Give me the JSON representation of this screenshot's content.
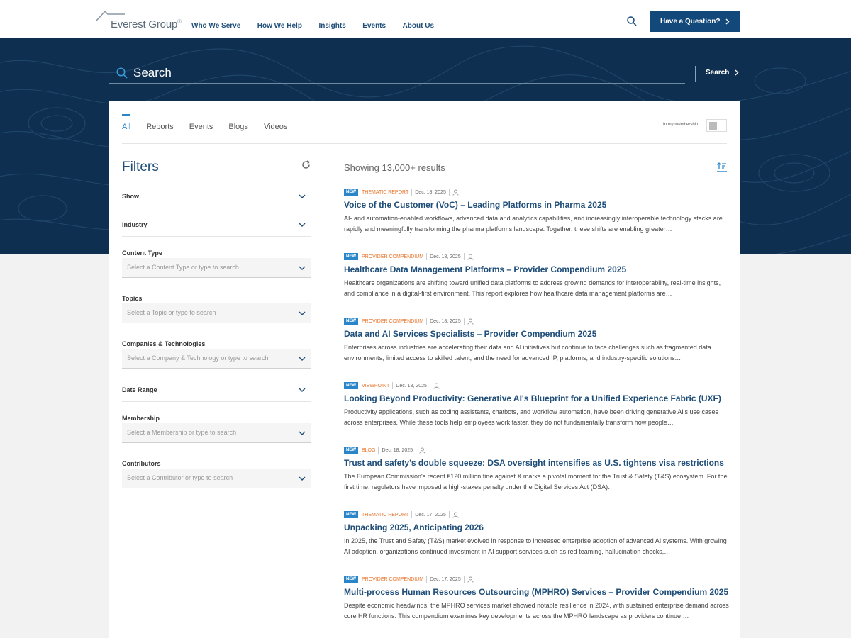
{
  "header": {
    "logo_text": "Everest Group",
    "logo_reg": "®",
    "nav": [
      "Who We Serve",
      "How We Help",
      "Insights",
      "Events",
      "About Us"
    ],
    "question_button": "Have a Question?"
  },
  "hero": {
    "search_placeholder": "Search",
    "search_button": "Search"
  },
  "tabs": [
    "All",
    "Reports",
    "Events",
    "Blogs",
    "Videos"
  ],
  "membership_label": "In my membership",
  "filters": {
    "title": "Filters",
    "items": [
      {
        "label": "Show",
        "placeholder": ""
      },
      {
        "label": "Industry",
        "placeholder": ""
      },
      {
        "label": "Content Type",
        "placeholder": "Select a Content Type or type to search"
      },
      {
        "label": "Topics",
        "placeholder": "Select a Topic or type to search"
      },
      {
        "label": "Companies & Technologies",
        "placeholder": "Select a Company & Technology or type to search"
      },
      {
        "label": "Date Range",
        "placeholder": ""
      },
      {
        "label": "Membership",
        "placeholder": "Select a Membership or type to search"
      },
      {
        "label": "Contributors",
        "placeholder": "Select a Contributor or type to search"
      }
    ]
  },
  "results": {
    "count_text": "Showing 13,000+ results",
    "items": [
      {
        "badge": "NEW",
        "type": "THEMATIC REPORT",
        "date": "Dec. 18, 2025",
        "title": "Voice of the Customer (VoC) – Leading Platforms in Pharma 2025",
        "desc": "AI- and automation-enabled workflows, advanced data and analytics capabilities, and increasingly interoperable technology stacks are rapidly and meaningfully transforming the pharma platforms landscape. Together, these shifts are enabling greater…"
      },
      {
        "badge": "NEW",
        "type": "PROVIDER COMPENDIUM",
        "date": "Dec. 18, 2025",
        "title": "Healthcare Data Management Platforms – Provider Compendium 2025",
        "desc": "Healthcare organizations are shifting toward unified data platforms to address growing demands for interoperability, real-time insights, and compliance in a digital-first environment. This report explores how healthcare data management platforms are…"
      },
      {
        "badge": "NEW",
        "type": "PROVIDER COMPENDIUM",
        "date": "Dec. 18, 2025",
        "title": "Data and AI Services Specialists – Provider Compendium 2025",
        "desc": "Enterprises across industries are accelerating their data and AI initiatives but continue to face challenges such as fragmented data environments, limited access to skilled talent, and the need for advanced IP, platforms, and industry-specific solutions.…"
      },
      {
        "badge": "NEW",
        "type": "VIEWPOINT",
        "date": "Dec. 18, 2025",
        "title": "Looking Beyond Productivity: Generative AI's Blueprint for a Unified Experience Fabric (UXF)",
        "desc": "Productivity applications, such as coding assistants, chatbots, and workflow automation, have been driving generative AI's use cases across enterprises. While these tools help employees work faster, they do not fundamentally transform how people…"
      },
      {
        "badge": "NEW",
        "type": "BLOG",
        "date": "Dec. 18, 2025",
        "title": "Trust and safety’s double squeeze: DSA oversight intensifies as U.S. tightens visa restrictions",
        "desc": "The European Commission's recent €120 million fine against X marks a pivotal moment for the Trust & Safety (T&S) ecosystem. For the first time, regulators have imposed a high-stakes penalty under the Digital Services Act (DSA)…"
      },
      {
        "badge": "NEW",
        "type": "THEMATIC REPORT",
        "date": "Dec. 17, 2025",
        "title": "Unpacking 2025, Anticipating 2026",
        "desc": "In 2025, the Trust and Safety (T&S) market evolved in response to increased enterprise adoption of advanced AI systems. With growing AI adoption, organizations continued investment in AI support services such as red teaming, hallucination checks,…"
      },
      {
        "badge": "NEW",
        "type": "PROVIDER COMPENDIUM",
        "date": "Dec. 17, 2025",
        "title": "Multi-process Human Resources Outsourcing (MPHRO) Services – Provider Compendium 2025",
        "desc": "Despite economic headwinds, the MPHRO services market showed notable resilience in 2024, with sustained enterprise demand across core HR functions. This compendium examines key developments across the MPHRO landscape as providers continue …"
      }
    ]
  },
  "colors": {
    "brand_navy": "#13497a",
    "hero_bg": "#0e2f4f",
    "accent_blue": "#2a86c9",
    "type_orange": "#e8732a"
  }
}
